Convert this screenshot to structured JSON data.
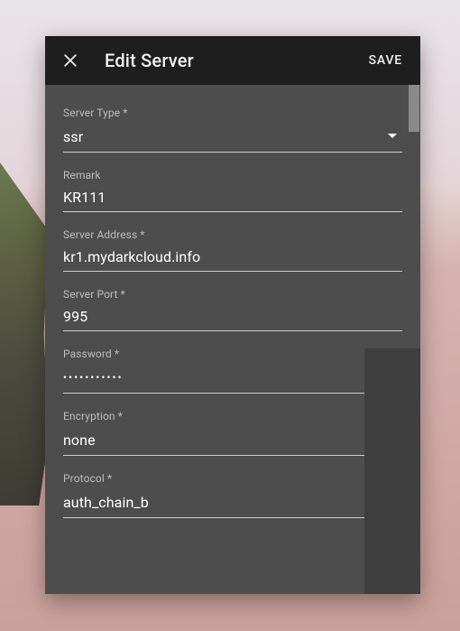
{
  "header": {
    "title": "Edit Server",
    "save_label": "SAVE"
  },
  "fields": {
    "server_type": {
      "label": "Server Type *",
      "value": "ssr"
    },
    "remark": {
      "label": "Remark",
      "value": "KR111"
    },
    "server_address": {
      "label": "Server Address *",
      "value": "kr1.mydarkcloud.info"
    },
    "server_port": {
      "label": "Server Port *",
      "value": "995"
    },
    "password": {
      "label": "Password *",
      "masked": "•••••••••••"
    },
    "encryption": {
      "label": "Encryption *",
      "value": "none"
    },
    "protocol": {
      "label": "Protocol *",
      "value": "auth_chain_b"
    }
  }
}
